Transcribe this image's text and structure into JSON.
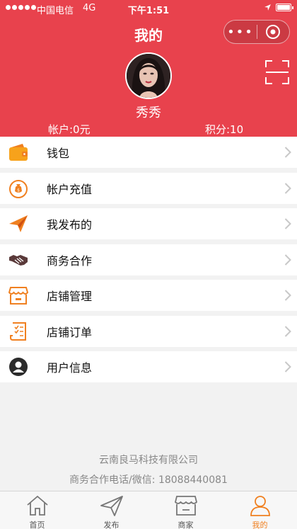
{
  "status_bar": {
    "carrier": "中国电信",
    "network": "4G",
    "time": "下午1:51"
  },
  "header": {
    "title": "我的"
  },
  "profile": {
    "username": "秀秀",
    "balance": "帐户:0元",
    "points": "积分:10"
  },
  "menu": [
    {
      "label": "钱包",
      "icon": "wallet-icon"
    },
    {
      "label": "帐户充值",
      "icon": "money-bag-icon"
    },
    {
      "label": "我发布的",
      "icon": "paper-plane-icon"
    },
    {
      "label": "商务合作",
      "icon": "handshake-icon"
    },
    {
      "label": "店铺管理",
      "icon": "store-icon"
    },
    {
      "label": "店铺订单",
      "icon": "order-list-icon"
    },
    {
      "label": "用户信息",
      "icon": "user-icon"
    }
  ],
  "footer": {
    "company": "云南良马科技有限公司",
    "contact": "商务合作电话/微信: 18088440081"
  },
  "tabbar": [
    {
      "label": "首页",
      "icon": "home-icon",
      "active": false
    },
    {
      "label": "发布",
      "icon": "send-icon",
      "active": false
    },
    {
      "label": "商家",
      "icon": "shop-icon",
      "active": false
    },
    {
      "label": "我的",
      "icon": "profile-icon",
      "active": true
    }
  ],
  "colors": {
    "header": "#e8424d",
    "accent": "#f08020",
    "active_tab": "#f08020"
  }
}
